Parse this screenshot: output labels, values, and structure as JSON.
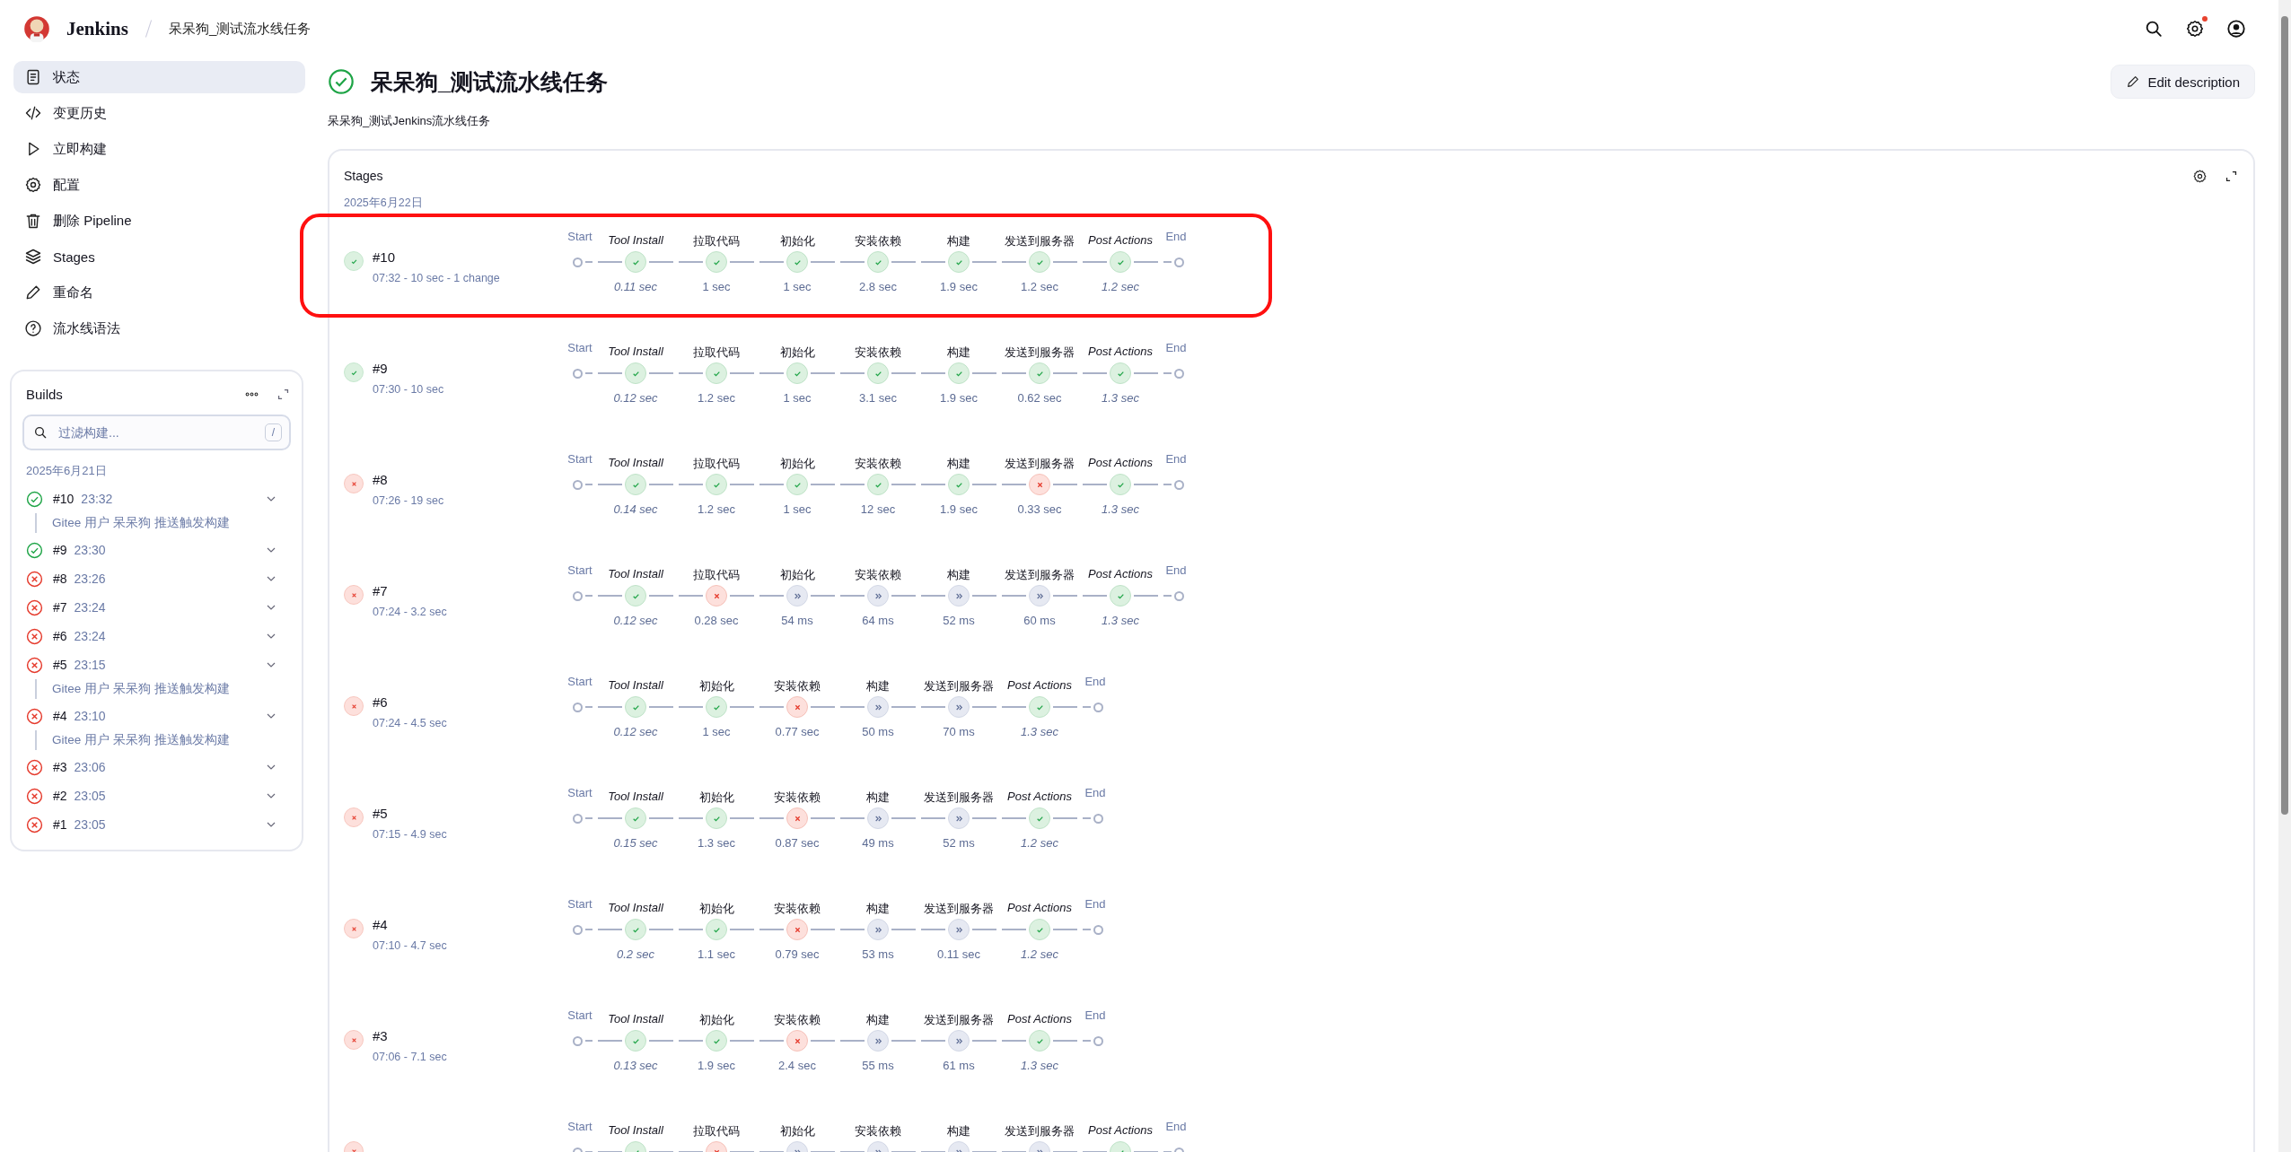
{
  "header": {
    "logo": "Jenkins",
    "breadcrumb": "呆呆狗_测试流水线任务",
    "notification": true
  },
  "sidebar": {
    "items": [
      {
        "label": "状态",
        "selected": true
      },
      {
        "label": "变更历史",
        "selected": false
      },
      {
        "label": "立即构建",
        "selected": false
      },
      {
        "label": "配置",
        "selected": false
      },
      {
        "label": "删除 Pipeline",
        "selected": false
      },
      {
        "label": "Stages",
        "selected": false
      },
      {
        "label": "重命名",
        "selected": false
      },
      {
        "label": "流水线语法",
        "selected": false
      }
    ]
  },
  "builds": {
    "title": "Builds",
    "filter": {
      "placeholder": "过滤构建...",
      "shortcut": "/"
    },
    "date": "2025年6月21日",
    "items": [
      {
        "number": "#10",
        "time": "23:32",
        "kind": "success",
        "cause": "Gitee 用户 呆呆狗 推送触发构建"
      },
      {
        "number": "#9",
        "time": "23:30",
        "kind": "success"
      },
      {
        "number": "#8",
        "time": "23:26",
        "kind": "failed"
      },
      {
        "number": "#7",
        "time": "23:24",
        "kind": "failed"
      },
      {
        "number": "#6",
        "time": "23:24",
        "kind": "failed"
      },
      {
        "number": "#5",
        "time": "23:15",
        "kind": "failed",
        "cause": "Gitee 用户 呆呆狗 推送触发构建"
      },
      {
        "number": "#4",
        "time": "23:10",
        "kind": "failed",
        "cause": "Gitee 用户 呆呆狗 推送触发构建"
      },
      {
        "number": "#3",
        "time": "23:06",
        "kind": "failed"
      },
      {
        "number": "#2",
        "time": "23:05",
        "kind": "failed"
      },
      {
        "number": "#1",
        "time": "23:05",
        "kind": "failed"
      }
    ]
  },
  "job": {
    "title": "呆呆狗_测试流水线任务",
    "kind": "success",
    "description": "呆呆狗_测试Jenkins流水线任务",
    "edit_button": "Edit description"
  },
  "stages": {
    "title": "Stages",
    "date": "2025年6月22日",
    "runs": [
      {
        "number": "#10",
        "summary": "07:32 - 10 sec - 1 change",
        "kind": "success",
        "highlighted": true,
        "start": "Start",
        "end": "End",
        "stages": [
          {
            "name": "Tool Install",
            "italic": true,
            "kind": "success",
            "duration": "0.11 sec"
          },
          {
            "name": "拉取代码",
            "italic": false,
            "kind": "success",
            "duration": "1 sec"
          },
          {
            "name": "初始化",
            "italic": false,
            "kind": "success",
            "duration": "1 sec"
          },
          {
            "name": "安装依赖",
            "italic": false,
            "kind": "success",
            "duration": "2.8 sec"
          },
          {
            "name": "构建",
            "italic": false,
            "kind": "success",
            "duration": "1.9 sec"
          },
          {
            "name": "发送到服务器",
            "italic": false,
            "kind": "success",
            "duration": "1.2 sec"
          },
          {
            "name": "Post Actions",
            "italic": true,
            "kind": "success",
            "duration": "1.2 sec"
          }
        ]
      },
      {
        "number": "#9",
        "summary": "07:30 - 10 sec",
        "kind": "success",
        "highlighted": false,
        "start": "Start",
        "end": "End",
        "stages": [
          {
            "name": "Tool Install",
            "italic": true,
            "kind": "success",
            "duration": "0.12 sec"
          },
          {
            "name": "拉取代码",
            "italic": false,
            "kind": "success",
            "duration": "1.2 sec"
          },
          {
            "name": "初始化",
            "italic": false,
            "kind": "success",
            "duration": "1 sec"
          },
          {
            "name": "安装依赖",
            "italic": false,
            "kind": "success",
            "duration": "3.1 sec"
          },
          {
            "name": "构建",
            "italic": false,
            "kind": "success",
            "duration": "1.9 sec"
          },
          {
            "name": "发送到服务器",
            "italic": false,
            "kind": "success",
            "duration": "0.62 sec"
          },
          {
            "name": "Post Actions",
            "italic": true,
            "kind": "success",
            "duration": "1.3 sec"
          }
        ]
      },
      {
        "number": "#8",
        "summary": "07:26 - 19 sec",
        "kind": "failed",
        "highlighted": false,
        "start": "Start",
        "end": "End",
        "stages": [
          {
            "name": "Tool Install",
            "italic": true,
            "kind": "success",
            "duration": "0.14 sec"
          },
          {
            "name": "拉取代码",
            "italic": false,
            "kind": "success",
            "duration": "1.2 sec"
          },
          {
            "name": "初始化",
            "italic": false,
            "kind": "success",
            "duration": "1 sec"
          },
          {
            "name": "安装依赖",
            "italic": false,
            "kind": "success",
            "duration": "12 sec"
          },
          {
            "name": "构建",
            "italic": false,
            "kind": "success",
            "duration": "1.9 sec"
          },
          {
            "name": "发送到服务器",
            "italic": false,
            "kind": "failed",
            "duration": "0.33 sec"
          },
          {
            "name": "Post Actions",
            "italic": true,
            "kind": "success",
            "duration": "1.3 sec"
          }
        ]
      },
      {
        "number": "#7",
        "summary": "07:24 - 3.2 sec",
        "kind": "failed",
        "highlighted": false,
        "start": "Start",
        "end": "End",
        "stages": [
          {
            "name": "Tool Install",
            "italic": true,
            "kind": "success",
            "duration": "0.12 sec"
          },
          {
            "name": "拉取代码",
            "italic": false,
            "kind": "failed",
            "duration": "0.28 sec"
          },
          {
            "name": "初始化",
            "italic": false,
            "kind": "skipped",
            "duration": "54 ms"
          },
          {
            "name": "安装依赖",
            "italic": false,
            "kind": "skipped",
            "duration": "64 ms"
          },
          {
            "name": "构建",
            "italic": false,
            "kind": "skipped",
            "duration": "52 ms"
          },
          {
            "name": "发送到服务器",
            "italic": false,
            "kind": "skipped",
            "duration": "60 ms"
          },
          {
            "name": "Post Actions",
            "italic": true,
            "kind": "success",
            "duration": "1.3 sec"
          }
        ]
      },
      {
        "number": "#6",
        "summary": "07:24 - 4.5 sec",
        "kind": "failed",
        "highlighted": false,
        "start": "Start",
        "end": "End",
        "stages": [
          {
            "name": "Tool Install",
            "italic": true,
            "kind": "success",
            "duration": "0.12 sec"
          },
          {
            "name": "初始化",
            "italic": false,
            "kind": "success",
            "duration": "1 sec"
          },
          {
            "name": "安装依赖",
            "italic": false,
            "kind": "failed",
            "duration": "0.77 sec"
          },
          {
            "name": "构建",
            "italic": false,
            "kind": "skipped",
            "duration": "50 ms"
          },
          {
            "name": "发送到服务器",
            "italic": false,
            "kind": "skipped",
            "duration": "70 ms"
          },
          {
            "name": "Post Actions",
            "italic": true,
            "kind": "success",
            "duration": "1.3 sec"
          }
        ]
      },
      {
        "number": "#5",
        "summary": "07:15 - 4.9 sec",
        "kind": "failed",
        "highlighted": false,
        "start": "Start",
        "end": "End",
        "stages": [
          {
            "name": "Tool Install",
            "italic": true,
            "kind": "success",
            "duration": "0.15 sec"
          },
          {
            "name": "初始化",
            "italic": false,
            "kind": "success",
            "duration": "1.3 sec"
          },
          {
            "name": "安装依赖",
            "italic": false,
            "kind": "failed",
            "duration": "0.87 sec"
          },
          {
            "name": "构建",
            "italic": false,
            "kind": "skipped",
            "duration": "49 ms"
          },
          {
            "name": "发送到服务器",
            "italic": false,
            "kind": "skipped",
            "duration": "52 ms"
          },
          {
            "name": "Post Actions",
            "italic": true,
            "kind": "success",
            "duration": "1.2 sec"
          }
        ]
      },
      {
        "number": "#4",
        "summary": "07:10 - 4.7 sec",
        "kind": "failed",
        "highlighted": false,
        "start": "Start",
        "end": "End",
        "stages": [
          {
            "name": "Tool Install",
            "italic": true,
            "kind": "success",
            "duration": "0.2 sec"
          },
          {
            "name": "初始化",
            "italic": false,
            "kind": "success",
            "duration": "1.1 sec"
          },
          {
            "name": "安装依赖",
            "italic": false,
            "kind": "failed",
            "duration": "0.79 sec"
          },
          {
            "name": "构建",
            "italic": false,
            "kind": "skipped",
            "duration": "53 ms"
          },
          {
            "name": "发送到服务器",
            "italic": false,
            "kind": "skipped",
            "duration": "0.11 sec"
          },
          {
            "name": "Post Actions",
            "italic": true,
            "kind": "success",
            "duration": "1.2 sec"
          }
        ]
      },
      {
        "number": "#3",
        "summary": "07:06 - 7.1 sec",
        "kind": "failed",
        "highlighted": false,
        "start": "Start",
        "end": "End",
        "stages": [
          {
            "name": "Tool Install",
            "italic": true,
            "kind": "success",
            "duration": "0.13 sec"
          },
          {
            "name": "初始化",
            "italic": false,
            "kind": "success",
            "duration": "1.9 sec"
          },
          {
            "name": "安装依赖",
            "italic": false,
            "kind": "failed",
            "duration": "2.4 sec"
          },
          {
            "name": "构建",
            "italic": false,
            "kind": "skipped",
            "duration": "55 ms"
          },
          {
            "name": "发送到服务器",
            "italic": false,
            "kind": "skipped",
            "duration": "61 ms"
          },
          {
            "name": "Post Actions",
            "italic": true,
            "kind": "success",
            "duration": "1.3 sec"
          }
        ]
      },
      {
        "kind": "failed",
        "highlighted": false,
        "start": "Start",
        "end": "End",
        "stages": [
          {
            "name": "Tool Install",
            "italic": true,
            "kind": "success"
          },
          {
            "name": "拉取代码",
            "italic": false,
            "kind": "failed"
          },
          {
            "name": "初始化",
            "italic": false,
            "kind": "skipped"
          },
          {
            "name": "安装依赖",
            "italic": false,
            "kind": "skipped"
          },
          {
            "name": "构建",
            "italic": false,
            "kind": "skipped"
          },
          {
            "name": "发送到服务器",
            "italic": false,
            "kind": "skipped"
          },
          {
            "name": "Post Actions",
            "italic": true,
            "kind": "success"
          }
        ]
      }
    ]
  }
}
